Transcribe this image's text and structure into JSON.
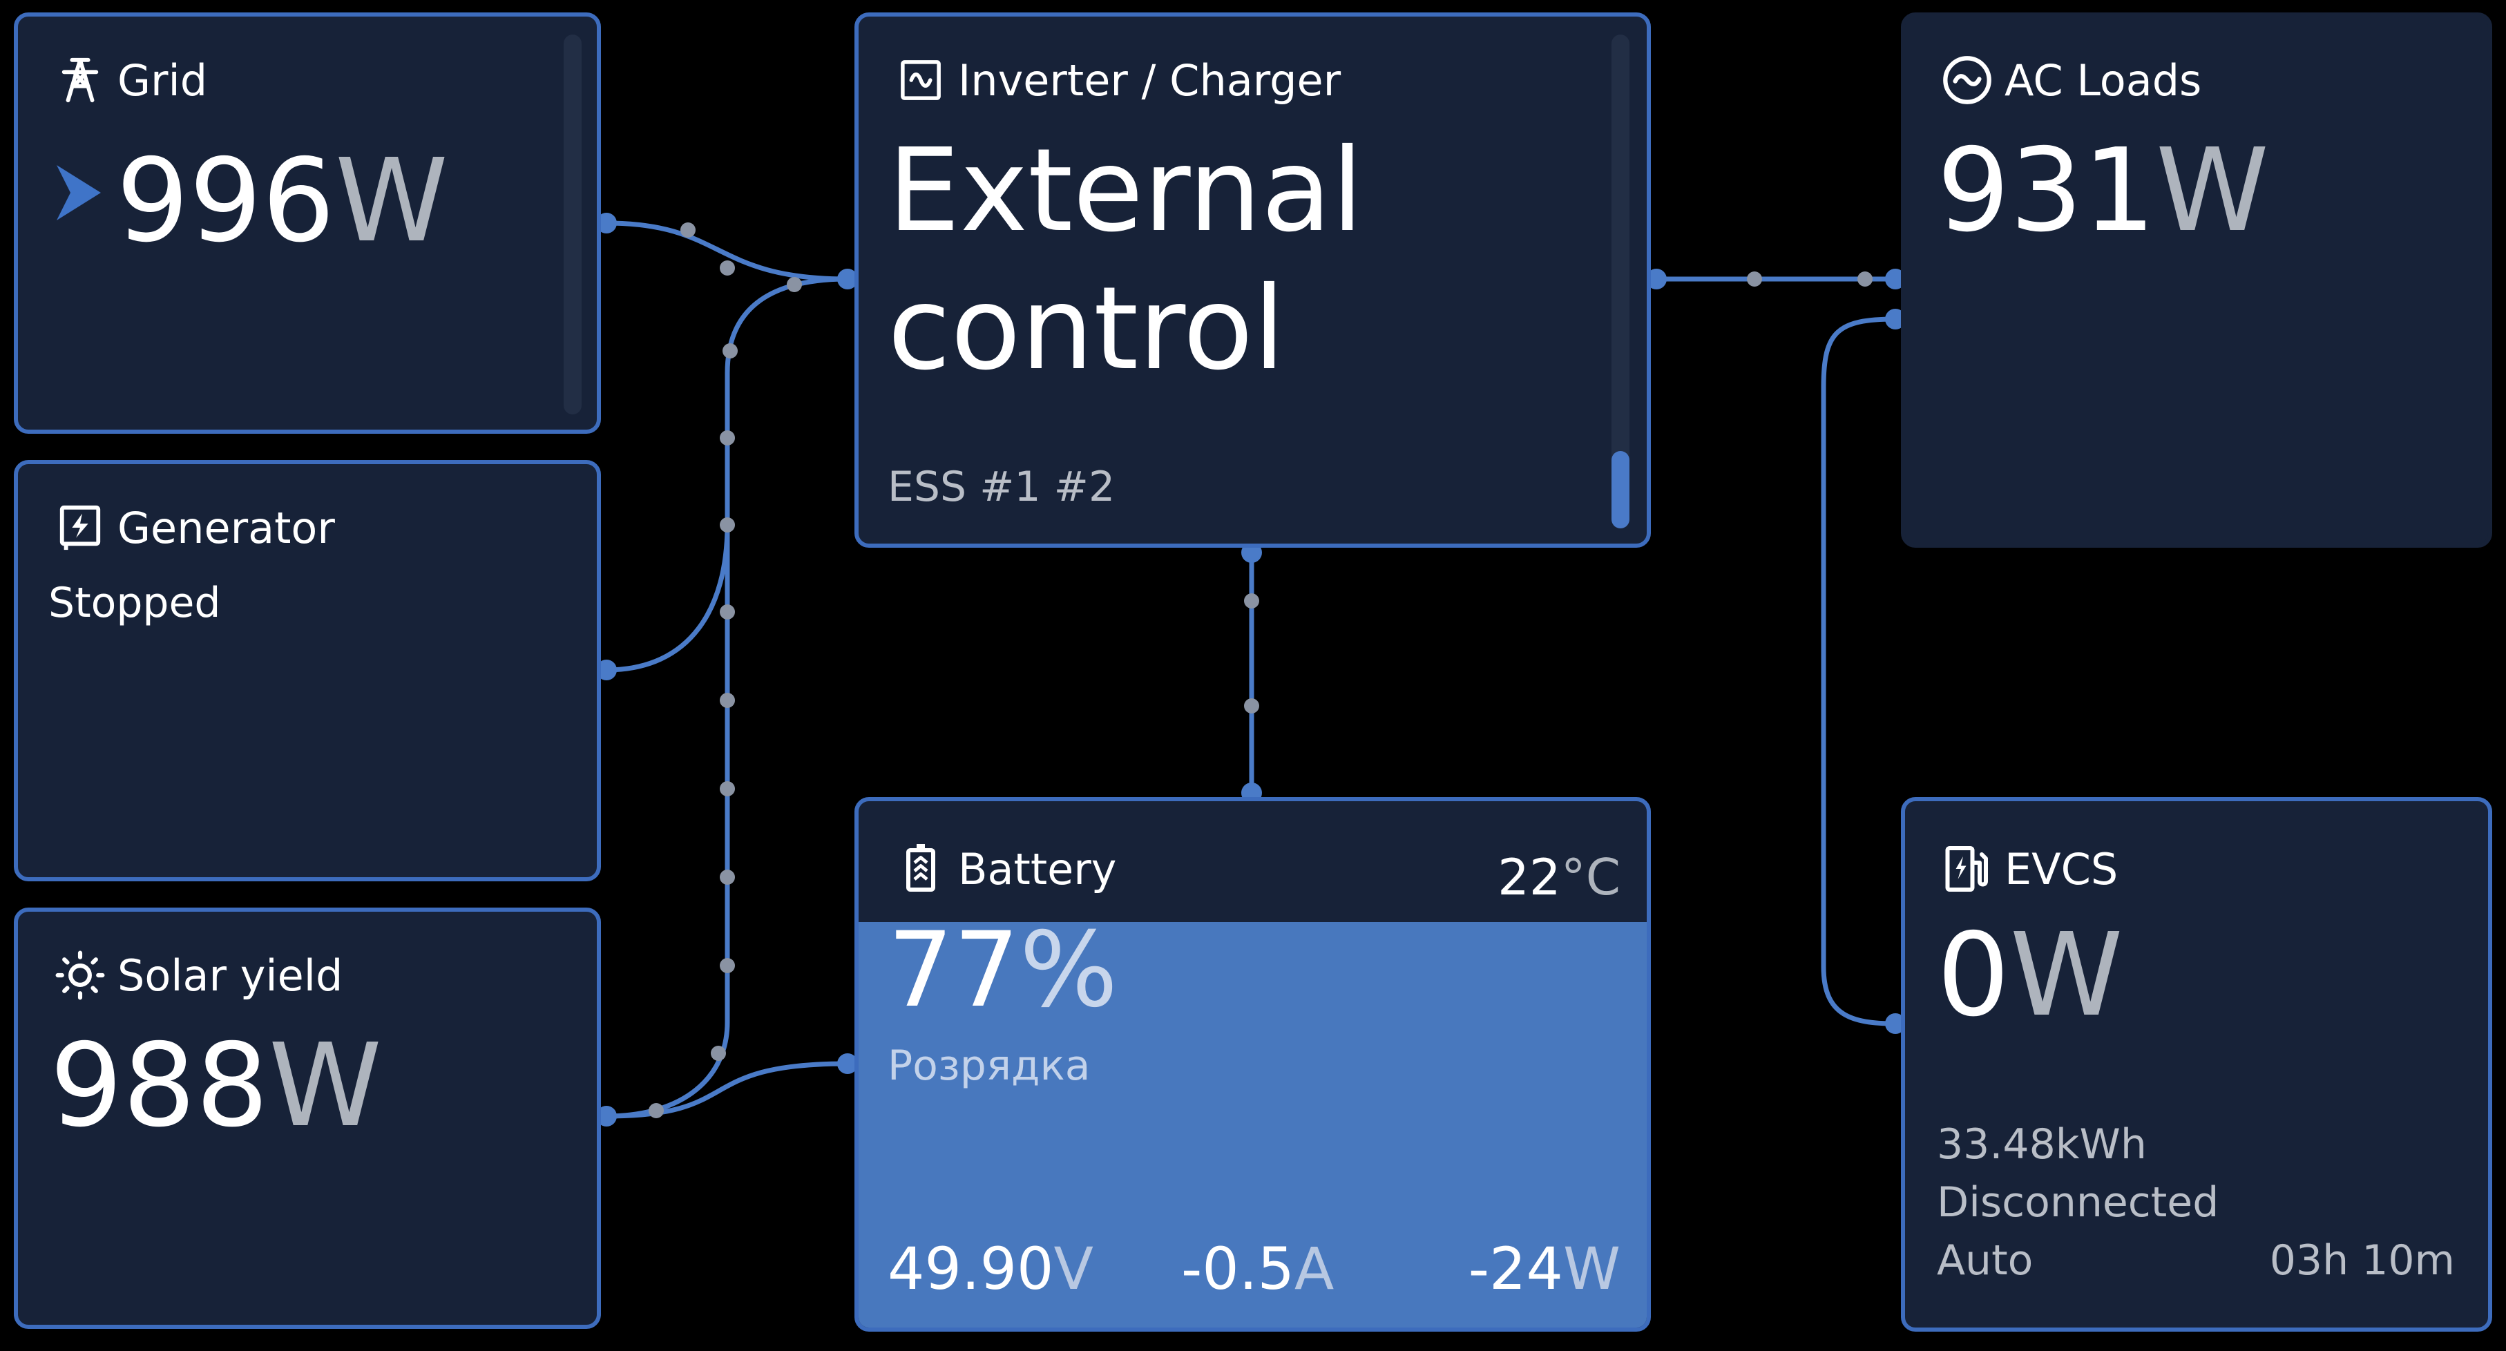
{
  "colors": {
    "background": "#000000",
    "card": "#172238",
    "card_border": "#3d6cbd",
    "wire": "#4a7bc8",
    "battery_fill": "#4878be",
    "unit_text": "#aeb4bd"
  },
  "grid": {
    "icon": "power-pylon-icon",
    "title": "Grid",
    "value": "996",
    "unit": "W",
    "direction_icon": "import-arrow-icon"
  },
  "generator": {
    "icon": "generator-icon",
    "title": "Generator",
    "status": "Stopped"
  },
  "solar": {
    "icon": "sun-icon",
    "title": "Solar yield",
    "value": "988",
    "unit": "W"
  },
  "inverter": {
    "icon": "inverter-icon",
    "title": "Inverter / Charger",
    "state_line1": "External",
    "state_line2": "control",
    "mode": "ESS #1 #2"
  },
  "battery": {
    "icon": "battery-icon",
    "title": "Battery",
    "temperature": "22",
    "temperature_unit": "°C",
    "soc": "77",
    "soc_unit": "%",
    "soc_fraction": 0.77,
    "status": "Розрядка",
    "voltage": "49.90",
    "voltage_unit": "V",
    "current": "-0.5",
    "current_unit": "A",
    "power": "-24",
    "power_unit": "W"
  },
  "ac_loads": {
    "icon": "ac-wave-icon",
    "title": "AC Loads",
    "value": "931",
    "unit": "W"
  },
  "evcs": {
    "icon": "ev-charger-icon",
    "title": "EVCS",
    "value": "0",
    "unit": "W",
    "energy": "33.48",
    "energy_unit": "kWh",
    "status": "Disconnected",
    "mode": "Auto",
    "session_time": "03h 10m"
  }
}
